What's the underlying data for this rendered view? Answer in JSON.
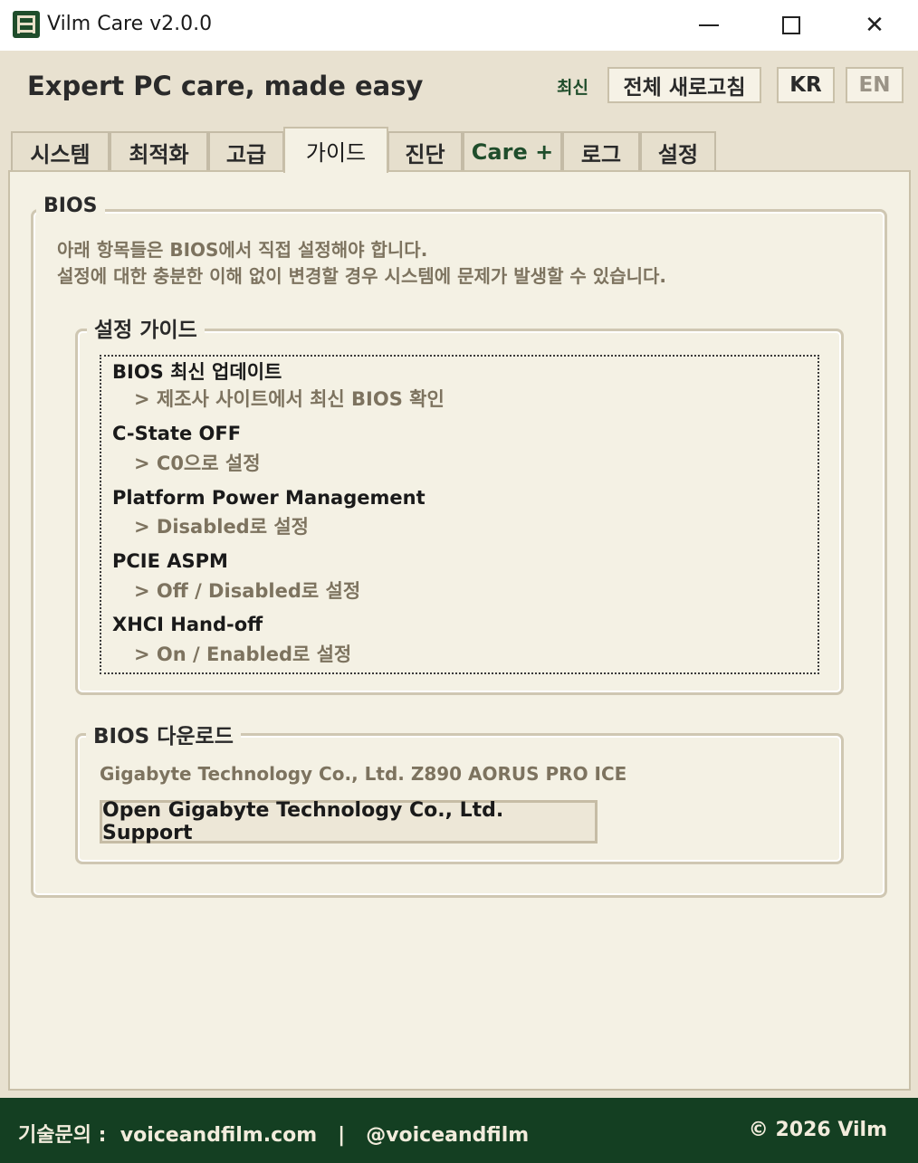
{
  "window": {
    "title": "Vilm Care v2.0.0",
    "minimize": "—",
    "close": "✕"
  },
  "header": {
    "tagline": "Expert PC care, made easy",
    "latest_label": "최신",
    "refresh_label": "전체 새로고침",
    "lang_kr": "KR",
    "lang_en": "EN"
  },
  "tabs": [
    {
      "label": "시스템"
    },
    {
      "label": "최적화"
    },
    {
      "label": "고급"
    },
    {
      "label": "가이드"
    },
    {
      "label": "진단"
    },
    {
      "label": "Care +"
    },
    {
      "label": "로그"
    },
    {
      "label": "설정"
    }
  ],
  "active_tab": "가이드",
  "bios": {
    "title": "BIOS",
    "desc_line1": "아래 항목들은 BIOS에서 직접 설정해야 합니다.",
    "desc_line2": "설정에 대한 충분한 이해 없이 변경할 경우 시스템에 문제가 발생할 수 있습니다.",
    "guide": {
      "title": "설정 가이드",
      "items": [
        {
          "name": "BIOS 최신 업데이트",
          "value": "> 제조사 사이트에서 최신 BIOS 확인"
        },
        {
          "name": "C-State OFF",
          "value": "> C0으로 설정"
        },
        {
          "name": "Platform Power Management",
          "value": "> Disabled로 설정"
        },
        {
          "name": "PCIE ASPM",
          "value": "> Off / Disabled로 설정"
        },
        {
          "name": "XHCI Hand-off",
          "value": "> On / Enabled로 설정"
        }
      ]
    },
    "download": {
      "title": "BIOS 다운로드",
      "board": "Gigabyte Technology Co., Ltd. Z890 AORUS PRO ICE",
      "button": "Open Gigabyte Technology Co., Ltd. Support"
    }
  },
  "footer": {
    "contact_label": "기술문의 :",
    "website": "voiceandfilm.com",
    "separator": "|",
    "handle": "@voiceandfilm",
    "copyright": "© 2026 Vilm"
  },
  "colors": {
    "brand_green": "#143f22",
    "accent_green": "#1f4d2b",
    "panel_bg": "#f4f1e4",
    "header_bg": "#e8e1d0",
    "muted_text": "#7d735f"
  }
}
